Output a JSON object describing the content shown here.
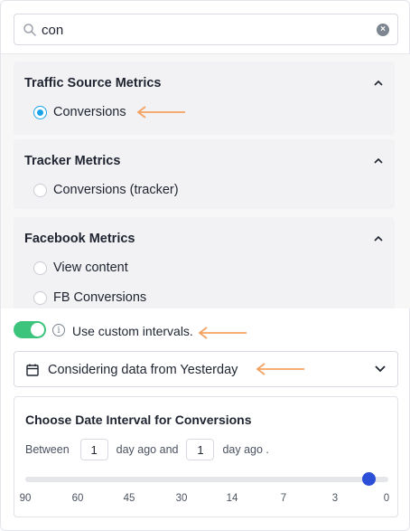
{
  "search": {
    "value": "con",
    "placeholder": ""
  },
  "groups": [
    {
      "title": "Traffic Source Metrics",
      "options": [
        {
          "label": "Conversions",
          "checked": true
        }
      ]
    },
    {
      "title": "Tracker Metrics",
      "options": [
        {
          "label": "Conversions (tracker)",
          "checked": false
        }
      ]
    },
    {
      "title": "Facebook Metrics",
      "options": [
        {
          "label": "View content",
          "checked": false
        },
        {
          "label": "FB Conversions",
          "checked": false
        }
      ]
    }
  ],
  "custom_intervals": {
    "label": "Use custom intervals.",
    "enabled": true
  },
  "data_range": {
    "label": "Considering data from Yesterday"
  },
  "interval": {
    "title": "Choose Date Interval for Conversions",
    "between_label": "Between",
    "from_value": "1",
    "middle_label": "day ago and",
    "to_value": "1",
    "end_label": "day ago .",
    "ticks": [
      "90",
      "60",
      "45",
      "30",
      "14",
      "7",
      "3",
      "0"
    ],
    "slider_value_days": 1
  },
  "colors": {
    "accent": "#1aa3e8",
    "toggle_on": "#3cc47c",
    "slider_knob": "#2c4fd8",
    "annotation_arrow": "#f4a261"
  }
}
